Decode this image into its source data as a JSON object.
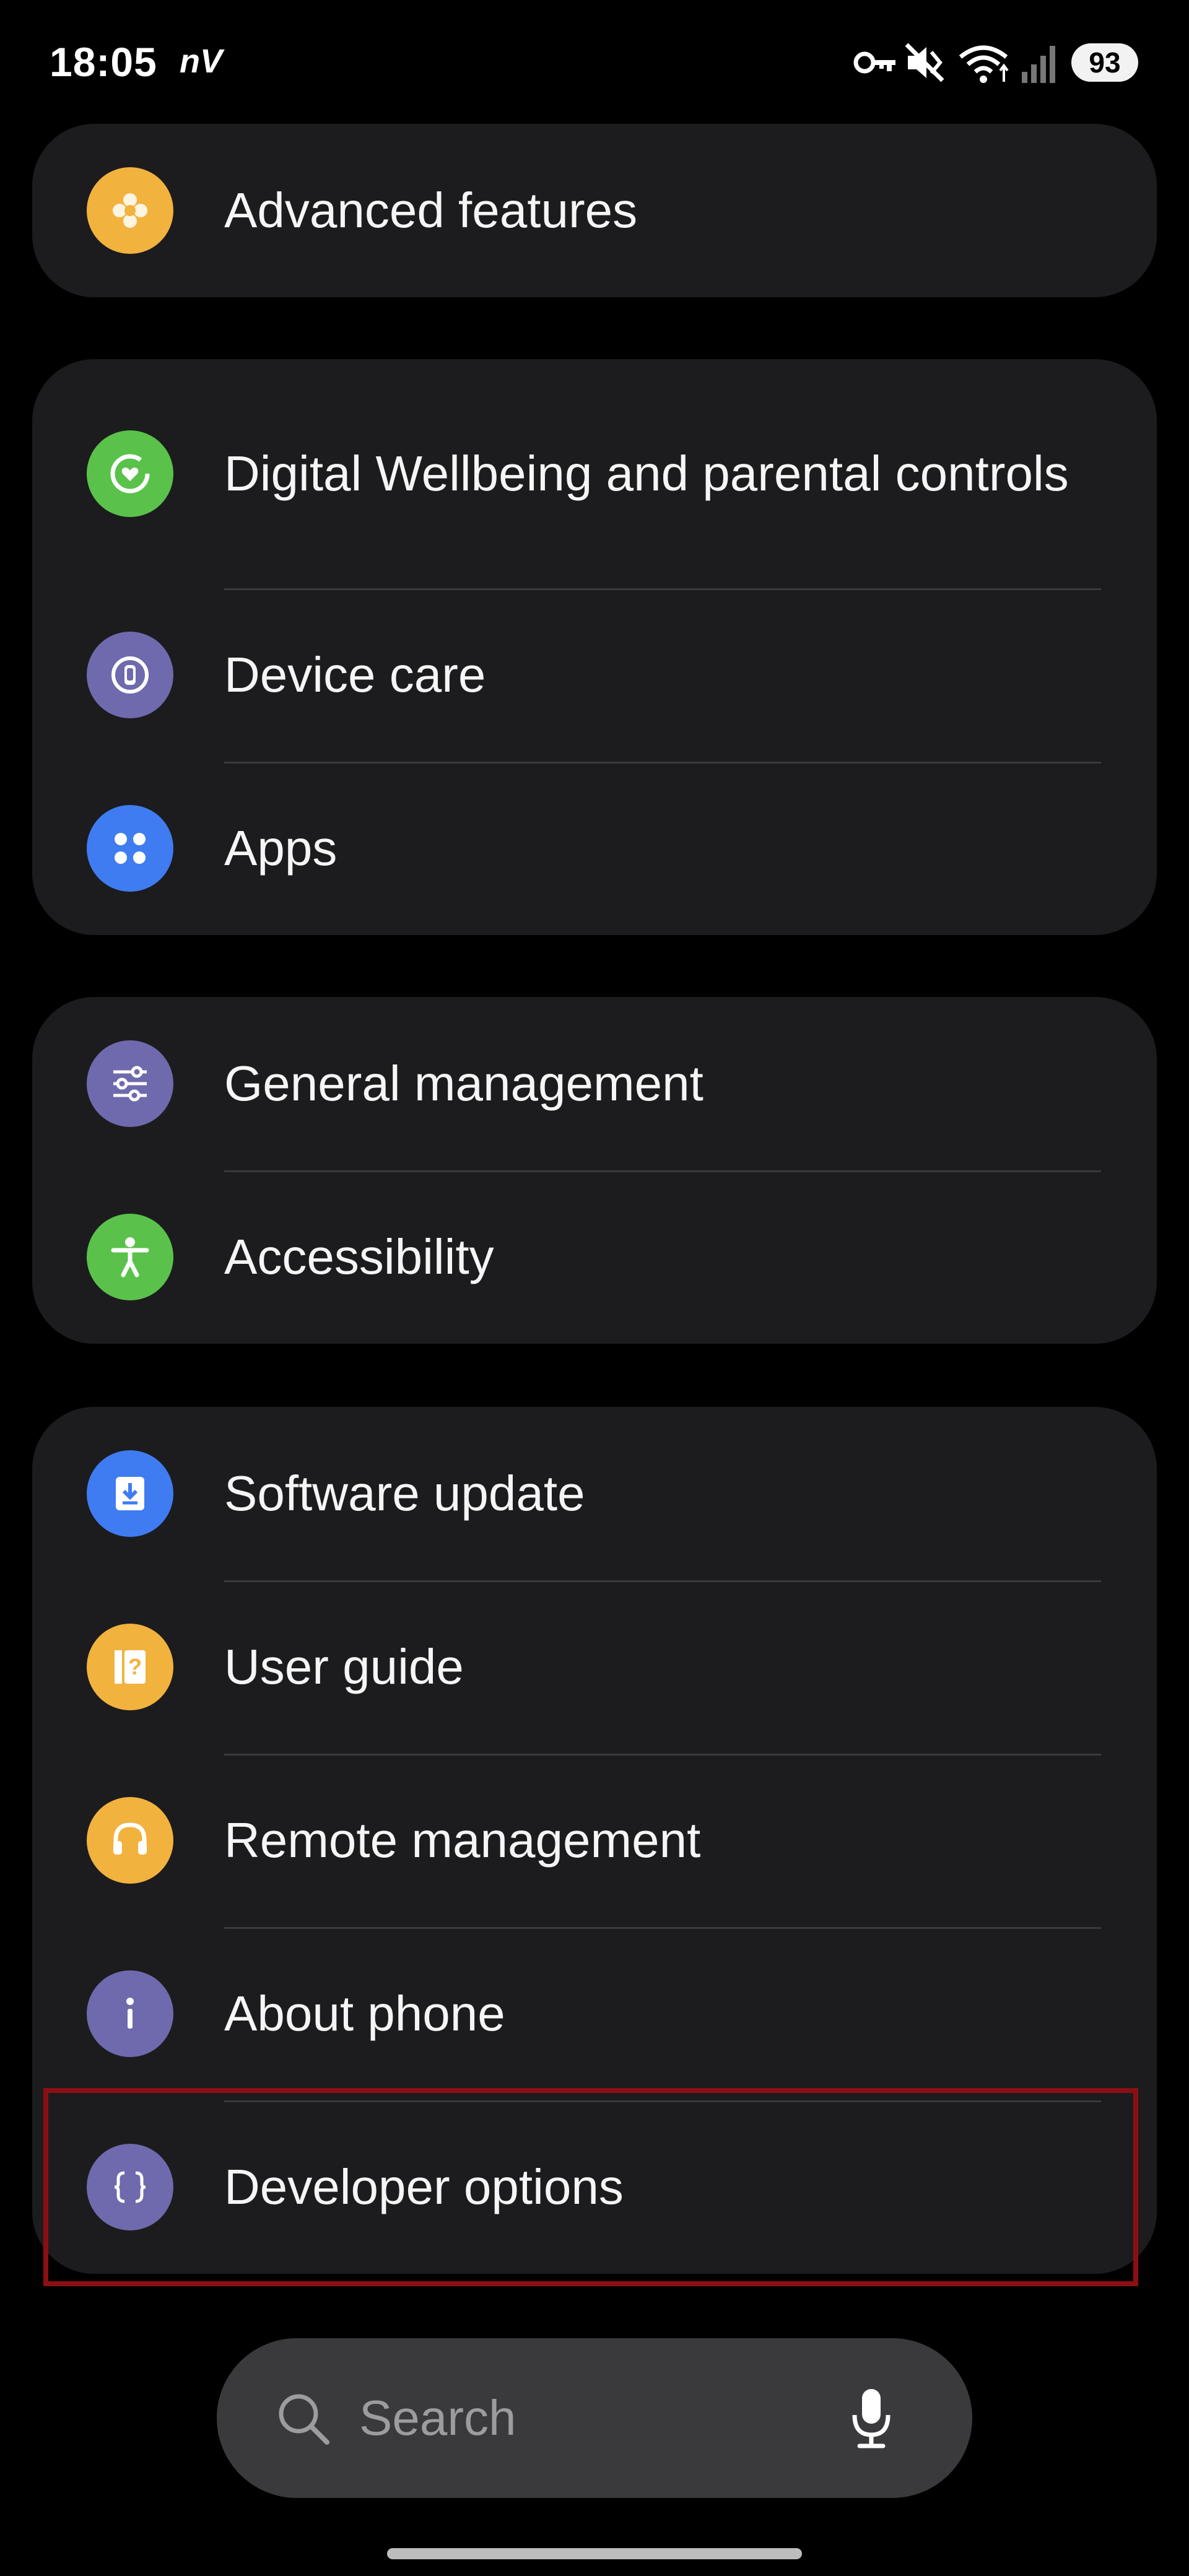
{
  "status_bar": {
    "time": "18:05",
    "carrier_icon": "nV",
    "battery": "93",
    "icons": [
      "key-icon",
      "mute-vibrate-icon",
      "wifi-icon",
      "signal-icon",
      "battery-icon"
    ]
  },
  "groups": [
    {
      "items": [
        {
          "label": "Advanced features",
          "icon": "advanced-features-icon",
          "color": "#f2b23e"
        }
      ]
    },
    {
      "items": [
        {
          "label": "Digital Wellbeing and parental controls",
          "icon": "wellbeing-icon",
          "color": "#5ac24b"
        },
        {
          "label": "Device care",
          "icon": "device-care-icon",
          "color": "#6e6aad"
        },
        {
          "label": "Apps",
          "icon": "apps-icon",
          "color": "#3f7cf1"
        }
      ]
    },
    {
      "items": [
        {
          "label": "General management",
          "icon": "sliders-icon",
          "color": "#6e6aad"
        },
        {
          "label": "Accessibility",
          "icon": "accessibility-icon",
          "color": "#5ac24b"
        }
      ]
    },
    {
      "items": [
        {
          "label": "Software update",
          "icon": "download-icon",
          "color": "#3f7cf1"
        },
        {
          "label": "User guide",
          "icon": "user-guide-icon",
          "color": "#f2b23e"
        },
        {
          "label": "Remote management",
          "icon": "headset-icon",
          "color": "#f2b23e"
        },
        {
          "label": "About phone",
          "icon": "info-icon",
          "color": "#6e6aad"
        },
        {
          "label": "Developer options",
          "icon": "braces-icon",
          "color": "#6e6aad"
        }
      ]
    }
  ],
  "search": {
    "placeholder": "Search"
  },
  "colors": {
    "background": "#000000",
    "card": "#1c1c1e",
    "highlight": "#8b0f12"
  }
}
